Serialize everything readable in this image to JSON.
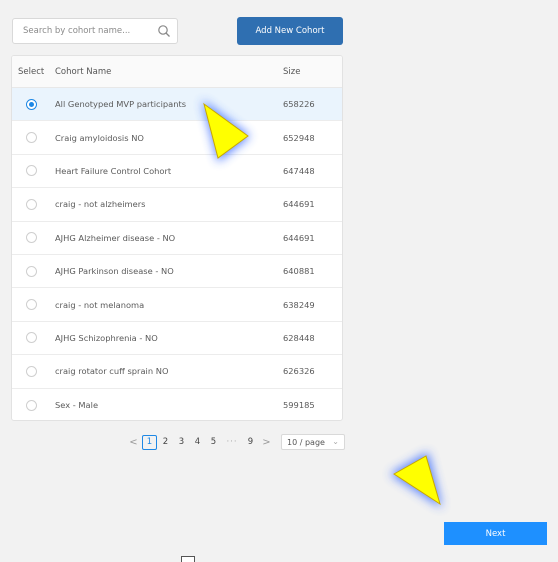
{
  "search": {
    "placeholder": "Search by cohort name..."
  },
  "toolbar": {
    "add_label": "Add New Cohort"
  },
  "table": {
    "headers": {
      "select": "Select",
      "name": "Cohort Name",
      "size": "Size"
    },
    "rows": [
      {
        "name": "All Genotyped MVP participants",
        "size": "658226",
        "selected": true
      },
      {
        "name": "Craig amyloidosis NO",
        "size": "652948",
        "selected": false
      },
      {
        "name": "Heart Failure Control Cohort",
        "size": "647448",
        "selected": false
      },
      {
        "name": "craig - not alzheimers",
        "size": "644691",
        "selected": false
      },
      {
        "name": "AJHG Alzheimer disease - NO",
        "size": "644691",
        "selected": false
      },
      {
        "name": "AJHG Parkinson disease - NO",
        "size": "640881",
        "selected": false
      },
      {
        "name": "craig - not melanoma",
        "size": "638249",
        "selected": false
      },
      {
        "name": "AJHG Schizophrenia - NO",
        "size": "628448",
        "selected": false
      },
      {
        "name": "craig rotator cuff sprain NO",
        "size": "626326",
        "selected": false
      },
      {
        "name": "Sex - Male",
        "size": "599185",
        "selected": false
      }
    ]
  },
  "pagination": {
    "prev": "<",
    "pages": [
      "1",
      "2",
      "3",
      "4",
      "5"
    ],
    "ellipsis": "···",
    "last": "9",
    "next": ">",
    "page_size": "10 / page",
    "current": "1"
  },
  "footer": {
    "next_label": "Next"
  },
  "icons": {
    "search": "search-icon",
    "radio": "radio-icon",
    "chevron": "chevron-down-icon",
    "pointer": "yellow-arrow-pointer"
  },
  "colors": {
    "primary": "#2f6fb1",
    "next": "#1e90ff",
    "selected_row": "#eaf4fd",
    "radio_checked": "#1e88e5"
  }
}
